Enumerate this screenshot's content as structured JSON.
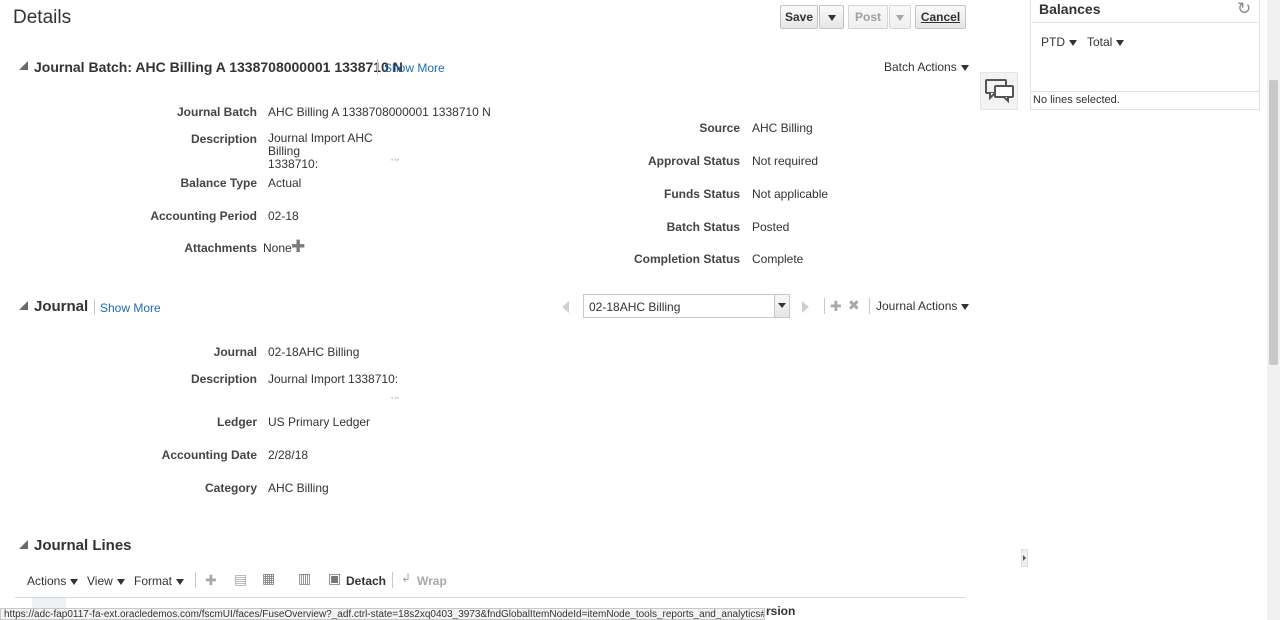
{
  "page": {
    "title": "Details"
  },
  "toolbar": {
    "save": "Save",
    "post": "Post",
    "cancel": "Cancel"
  },
  "journal_batch": {
    "section_title": "Journal Batch: AHC Billing A 1338708000001 1338710 N",
    "show_more": "Show More",
    "actions_label": "Batch Actions",
    "fields_left": [
      {
        "label": "Journal Batch",
        "value": "AHC Billing A 1338708000001 1338710 N"
      },
      {
        "label": "Description",
        "value": "Journal Import AHC Billing\n1338710:"
      },
      {
        "label": "Balance Type",
        "value": "Actual"
      },
      {
        "label": "Accounting Period",
        "value": "02-18"
      },
      {
        "label": "Attachments",
        "value": "None"
      }
    ],
    "fields_right": [
      {
        "label": "Source",
        "value": "AHC Billing"
      },
      {
        "label": "Approval Status",
        "value": "Not required"
      },
      {
        "label": "Funds Status",
        "value": "Not applicable"
      },
      {
        "label": "Batch Status",
        "value": "Posted"
      },
      {
        "label": "Completion Status",
        "value": "Complete"
      }
    ]
  },
  "journal": {
    "section_title": "Journal",
    "show_more": "Show More",
    "selected_journal": "02-18AHC Billing",
    "actions_label": "Journal Actions",
    "fields": [
      {
        "label": "Journal",
        "value": "02-18AHC Billing"
      },
      {
        "label": "Description",
        "value": "Journal Import 1338710:"
      },
      {
        "label": "Ledger",
        "value": "US Primary Ledger"
      },
      {
        "label": "Accounting Date",
        "value": "2/28/18"
      },
      {
        "label": "Category",
        "value": "AHC Billing"
      }
    ]
  },
  "journal_lines": {
    "section_title": "Journal Lines",
    "menus": {
      "actions": "Actions",
      "view": "View",
      "format": "Format"
    },
    "detach": "Detach",
    "wrap": "Wrap",
    "partial_header": "rsion"
  },
  "balances": {
    "title": "Balances",
    "ptd": "PTD",
    "total": "Total",
    "empty_text": "No lines selected."
  },
  "statusbar": {
    "url": "https://adc-fap0117-fa-ext.oracledemos.com/fscmUI/faces/FuseOverview?_adf.ctrl-state=18s2xq0403_3973&fndGlobalItemNodeId=itemNode_tools_reports_and_analytics#"
  },
  "colors": {
    "link": "#1f6bb5",
    "disabled": "#a0a0a0"
  }
}
